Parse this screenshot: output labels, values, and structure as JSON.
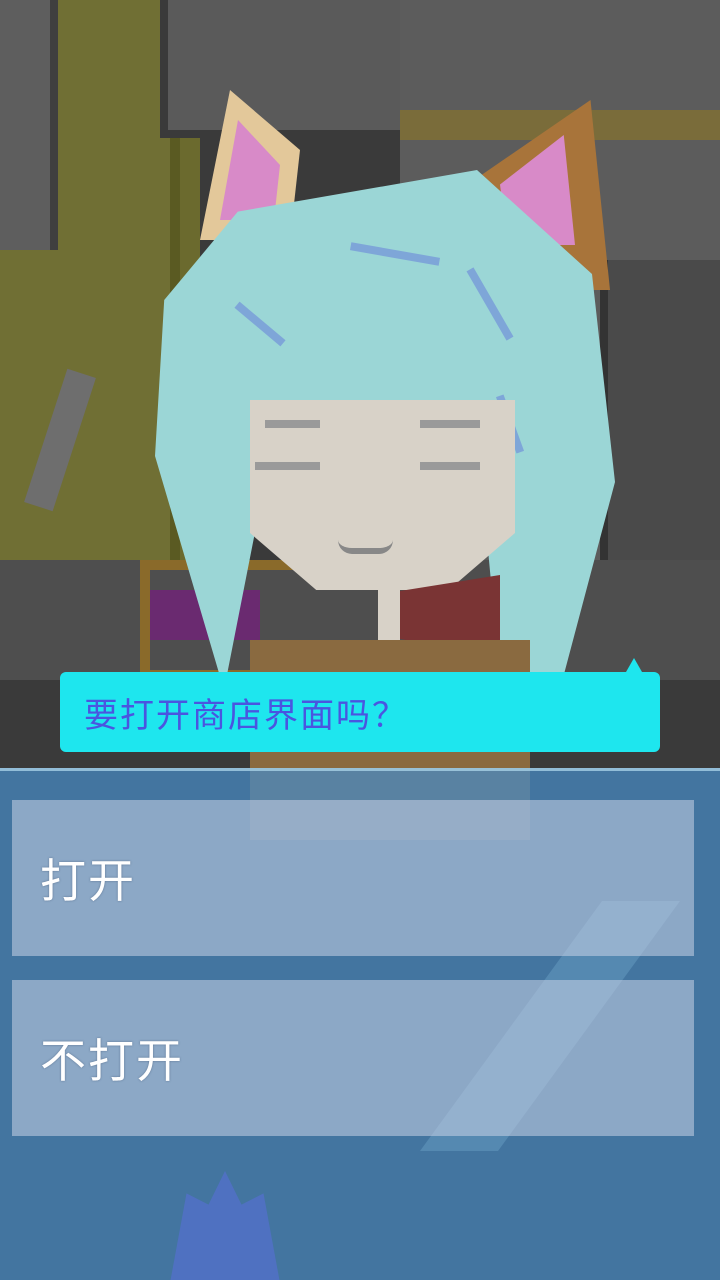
{
  "dialog": {
    "question": "要打开商店界面吗？",
    "bubble_color": "#1ee6ee",
    "text_color": "#4a55e0"
  },
  "choices": [
    {
      "label": "打开"
    },
    {
      "label": "不打开"
    }
  ],
  "scene": {
    "character": "cat-eared-girl-icon",
    "panel_color": "#468cc8"
  }
}
